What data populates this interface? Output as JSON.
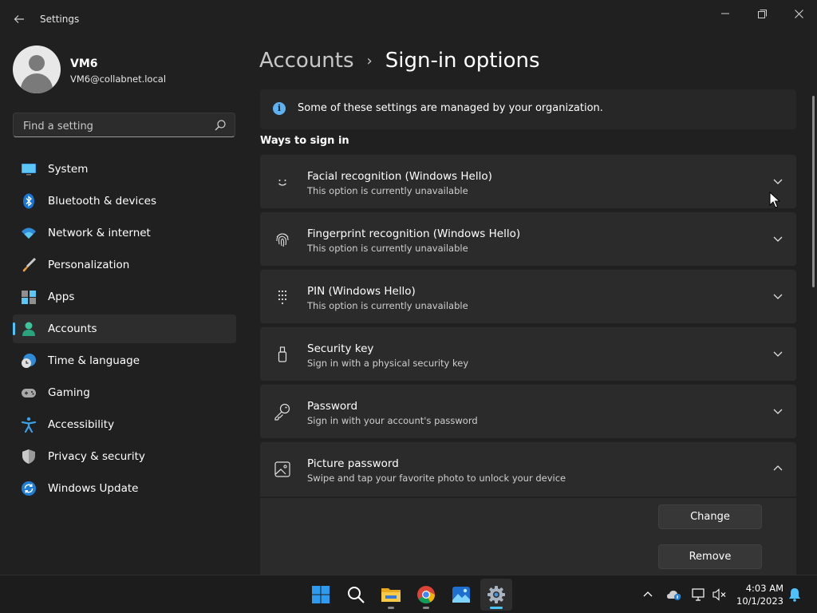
{
  "window": {
    "title": "Settings"
  },
  "user": {
    "name": "VM6",
    "email": "VM6@collabnet.local"
  },
  "search": {
    "placeholder": "Find a setting"
  },
  "sidebar": {
    "items": [
      {
        "label": "System",
        "icon": "monitor-icon"
      },
      {
        "label": "Bluetooth & devices",
        "icon": "bluetooth-icon"
      },
      {
        "label": "Network & internet",
        "icon": "wifi-icon"
      },
      {
        "label": "Personalization",
        "icon": "paintbrush-icon"
      },
      {
        "label": "Apps",
        "icon": "apps-icon"
      },
      {
        "label": "Accounts",
        "icon": "person-icon",
        "selected": true
      },
      {
        "label": "Time & language",
        "icon": "globe-clock-icon"
      },
      {
        "label": "Gaming",
        "icon": "gamepad-icon"
      },
      {
        "label": "Accessibility",
        "icon": "accessibility-icon"
      },
      {
        "label": "Privacy & security",
        "icon": "shield-icon"
      },
      {
        "label": "Windows Update",
        "icon": "update-icon"
      }
    ]
  },
  "breadcrumb": {
    "parent": "Accounts",
    "separator": "›",
    "current": "Sign-in options"
  },
  "info": {
    "text": "Some of these settings are managed by your organization."
  },
  "section": {
    "title": "Ways to sign in"
  },
  "options": [
    {
      "title": "Facial recognition (Windows Hello)",
      "subtitle": "This option is currently unavailable",
      "icon": "face-icon",
      "expanded": false
    },
    {
      "title": "Fingerprint recognition (Windows Hello)",
      "subtitle": "This option is currently unavailable",
      "icon": "fingerprint-icon",
      "expanded": false
    },
    {
      "title": "PIN (Windows Hello)",
      "subtitle": "This option is currently unavailable",
      "icon": "pin-keypad-icon",
      "expanded": false
    },
    {
      "title": "Security key",
      "subtitle": "Sign in with a physical security key",
      "icon": "usb-key-icon",
      "expanded": false
    },
    {
      "title": "Password",
      "subtitle": "Sign in with your account's password",
      "icon": "key-icon",
      "expanded": false
    },
    {
      "title": "Picture password",
      "subtitle": "Swipe and tap your favorite photo to unlock your device",
      "icon": "picture-icon",
      "expanded": true
    }
  ],
  "picture_password": {
    "change_label": "Change",
    "remove_label": "Remove"
  },
  "taskbar": {
    "time": "4:03 AM",
    "date": "10/1/2023",
    "apps": [
      "start-icon",
      "search-icon",
      "file-explorer-icon",
      "chrome-icon",
      "photos-icon",
      "settings-icon"
    ]
  },
  "colors": {
    "accent": "#4cc2ff",
    "background": "#202020",
    "card": "#2b2b2b"
  }
}
